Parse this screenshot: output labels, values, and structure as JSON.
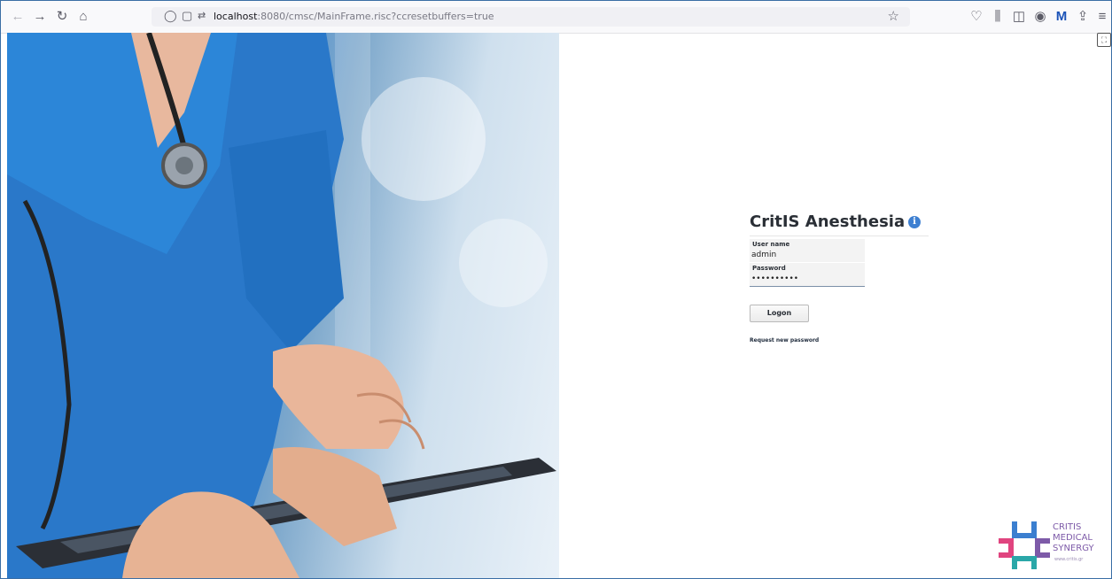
{
  "browser": {
    "url_host": "localhost",
    "url_rest": ":8080/cmsc/MainFrame.risc?ccresetbuffers=true",
    "icons": [
      "back-icon",
      "forward-icon",
      "reload-icon",
      "home-icon",
      "shield-icon",
      "page-icon",
      "permissions-icon",
      "star-icon",
      "pocket-icon",
      "library-icon",
      "sidebar-icon",
      "account-icon",
      "extension-icon",
      "share-icon",
      "menu-icon"
    ]
  },
  "login": {
    "title": "CritIS Anesthesia",
    "info_glyph": "i",
    "username_label": "User name",
    "username_value": "admin",
    "password_label": "Password",
    "password_value": "••••••••••",
    "logon_label": "Logon",
    "request_password_label": "Request new password"
  },
  "logo": {
    "line1": "CRITIS",
    "line2": "MEDICAL",
    "line3": "SYNERGY",
    "url": "www.critis.gr",
    "colors": {
      "purple": "#7d5aa8",
      "pink": "#e0447f",
      "teal": "#2aa7a8",
      "blue": "#3b7fd0"
    }
  }
}
